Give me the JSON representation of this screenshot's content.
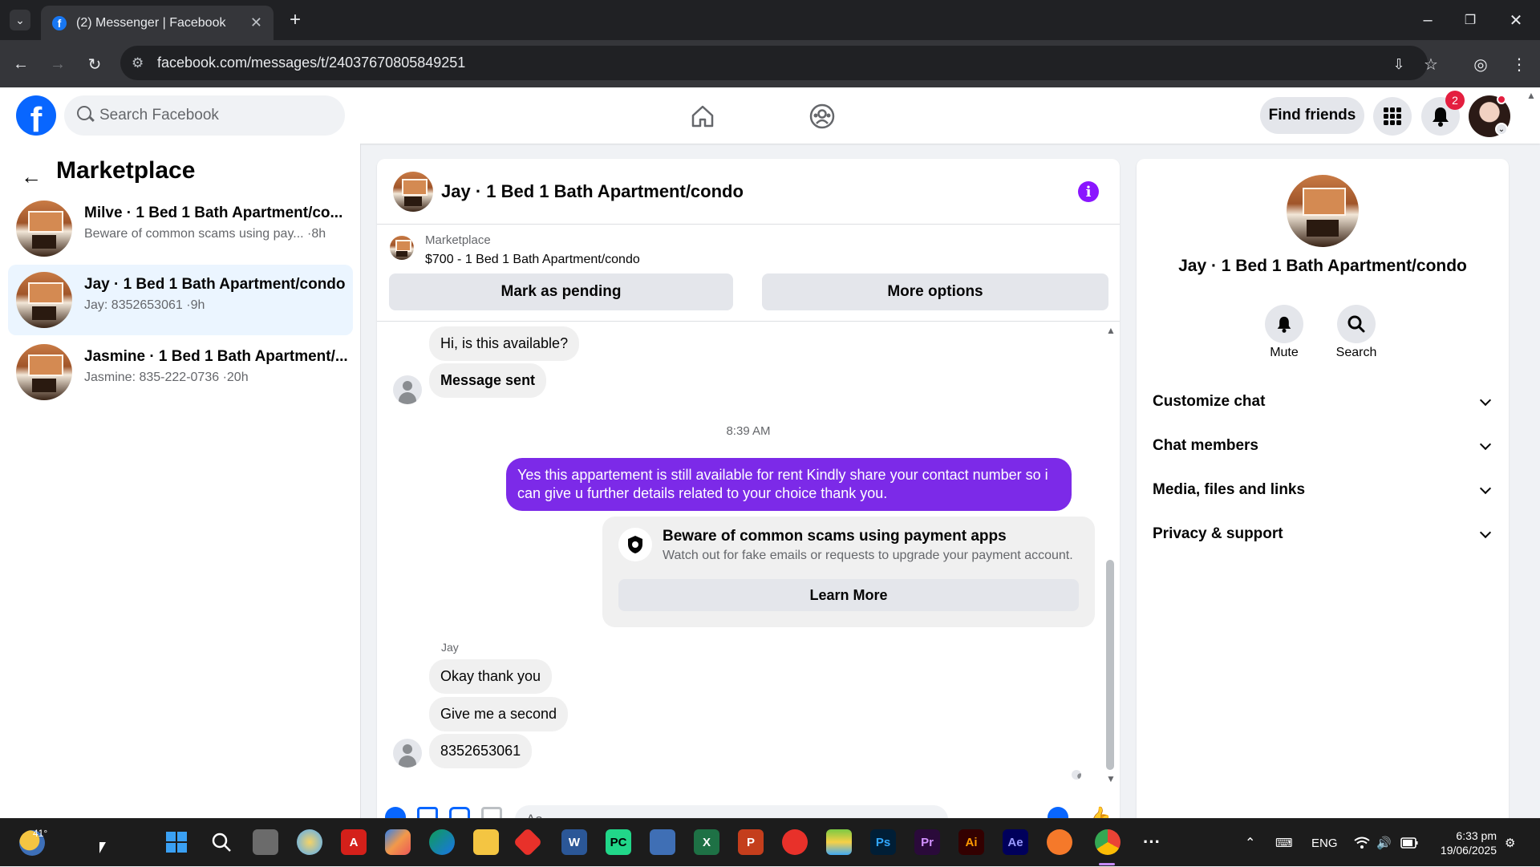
{
  "browser": {
    "tab_title": "(2) Messenger | Facebook",
    "url": "facebook.com/messages/t/24037670805849251"
  },
  "fb_header": {
    "search_placeholder": "Search Facebook",
    "find_friends": "Find friends",
    "notification_count": "2"
  },
  "left_panel": {
    "title": "Marketplace",
    "conversations": [
      {
        "name": "Milve · 1 Bed 1 Bath Apartment/co...",
        "snippet": "Beware of common scams using pay...",
        "time": "·8h",
        "active": false
      },
      {
        "name": "Jay · 1 Bed 1 Bath Apartment/condo",
        "snippet": "Jay: 8352653061",
        "time": "·9h",
        "active": true
      },
      {
        "name": "Jasmine · 1 Bed 1 Bath Apartment/...",
        "snippet": "Jasmine: 835-222-0736",
        "time": "·20h",
        "active": false
      }
    ]
  },
  "chat": {
    "title": "Jay · 1 Bed 1 Bath Apartment/condo",
    "marketplace_label": "Marketplace",
    "listing": "$700 - 1 Bed 1 Bath Apartment/condo",
    "mark_pending": "Mark as pending",
    "more_options": "More options",
    "messages": {
      "m1": "Hi, is this available?",
      "m2": "Message sent",
      "timestamp": "8:39 AM",
      "out1": "Yes this appartement is still available for rent Kindly share your contact number so i can give u further details related to your choice thank you.",
      "sender": "Jay",
      "r1": "Okay thank you",
      "r2": "Give me a second",
      "r3": "8352653061"
    },
    "scam_card": {
      "title": "Beware of common scams using payment apps",
      "subtitle": "Watch out for fake emails or requests to upgrade your payment account.",
      "button": "Learn More"
    },
    "composer_placeholder": "Aa"
  },
  "right_panel": {
    "name": "Jay · 1 Bed 1 Bath Apartment/condo",
    "mute": "Mute",
    "search": "Search",
    "rows": [
      "Customize chat",
      "Chat members",
      "Media, files and links",
      "Privacy & support"
    ]
  },
  "taskbar": {
    "weather": "41°",
    "language": "ENG",
    "time": "6:33 pm",
    "date": "19/06/2025",
    "apps": [
      "PC",
      "Ps",
      "Pr",
      "Ai",
      "Ae"
    ]
  },
  "colors": {
    "brand": "#0866ff",
    "outgoing_bubble": "#7c2ae8",
    "active_conv": "#ebf5ff"
  }
}
